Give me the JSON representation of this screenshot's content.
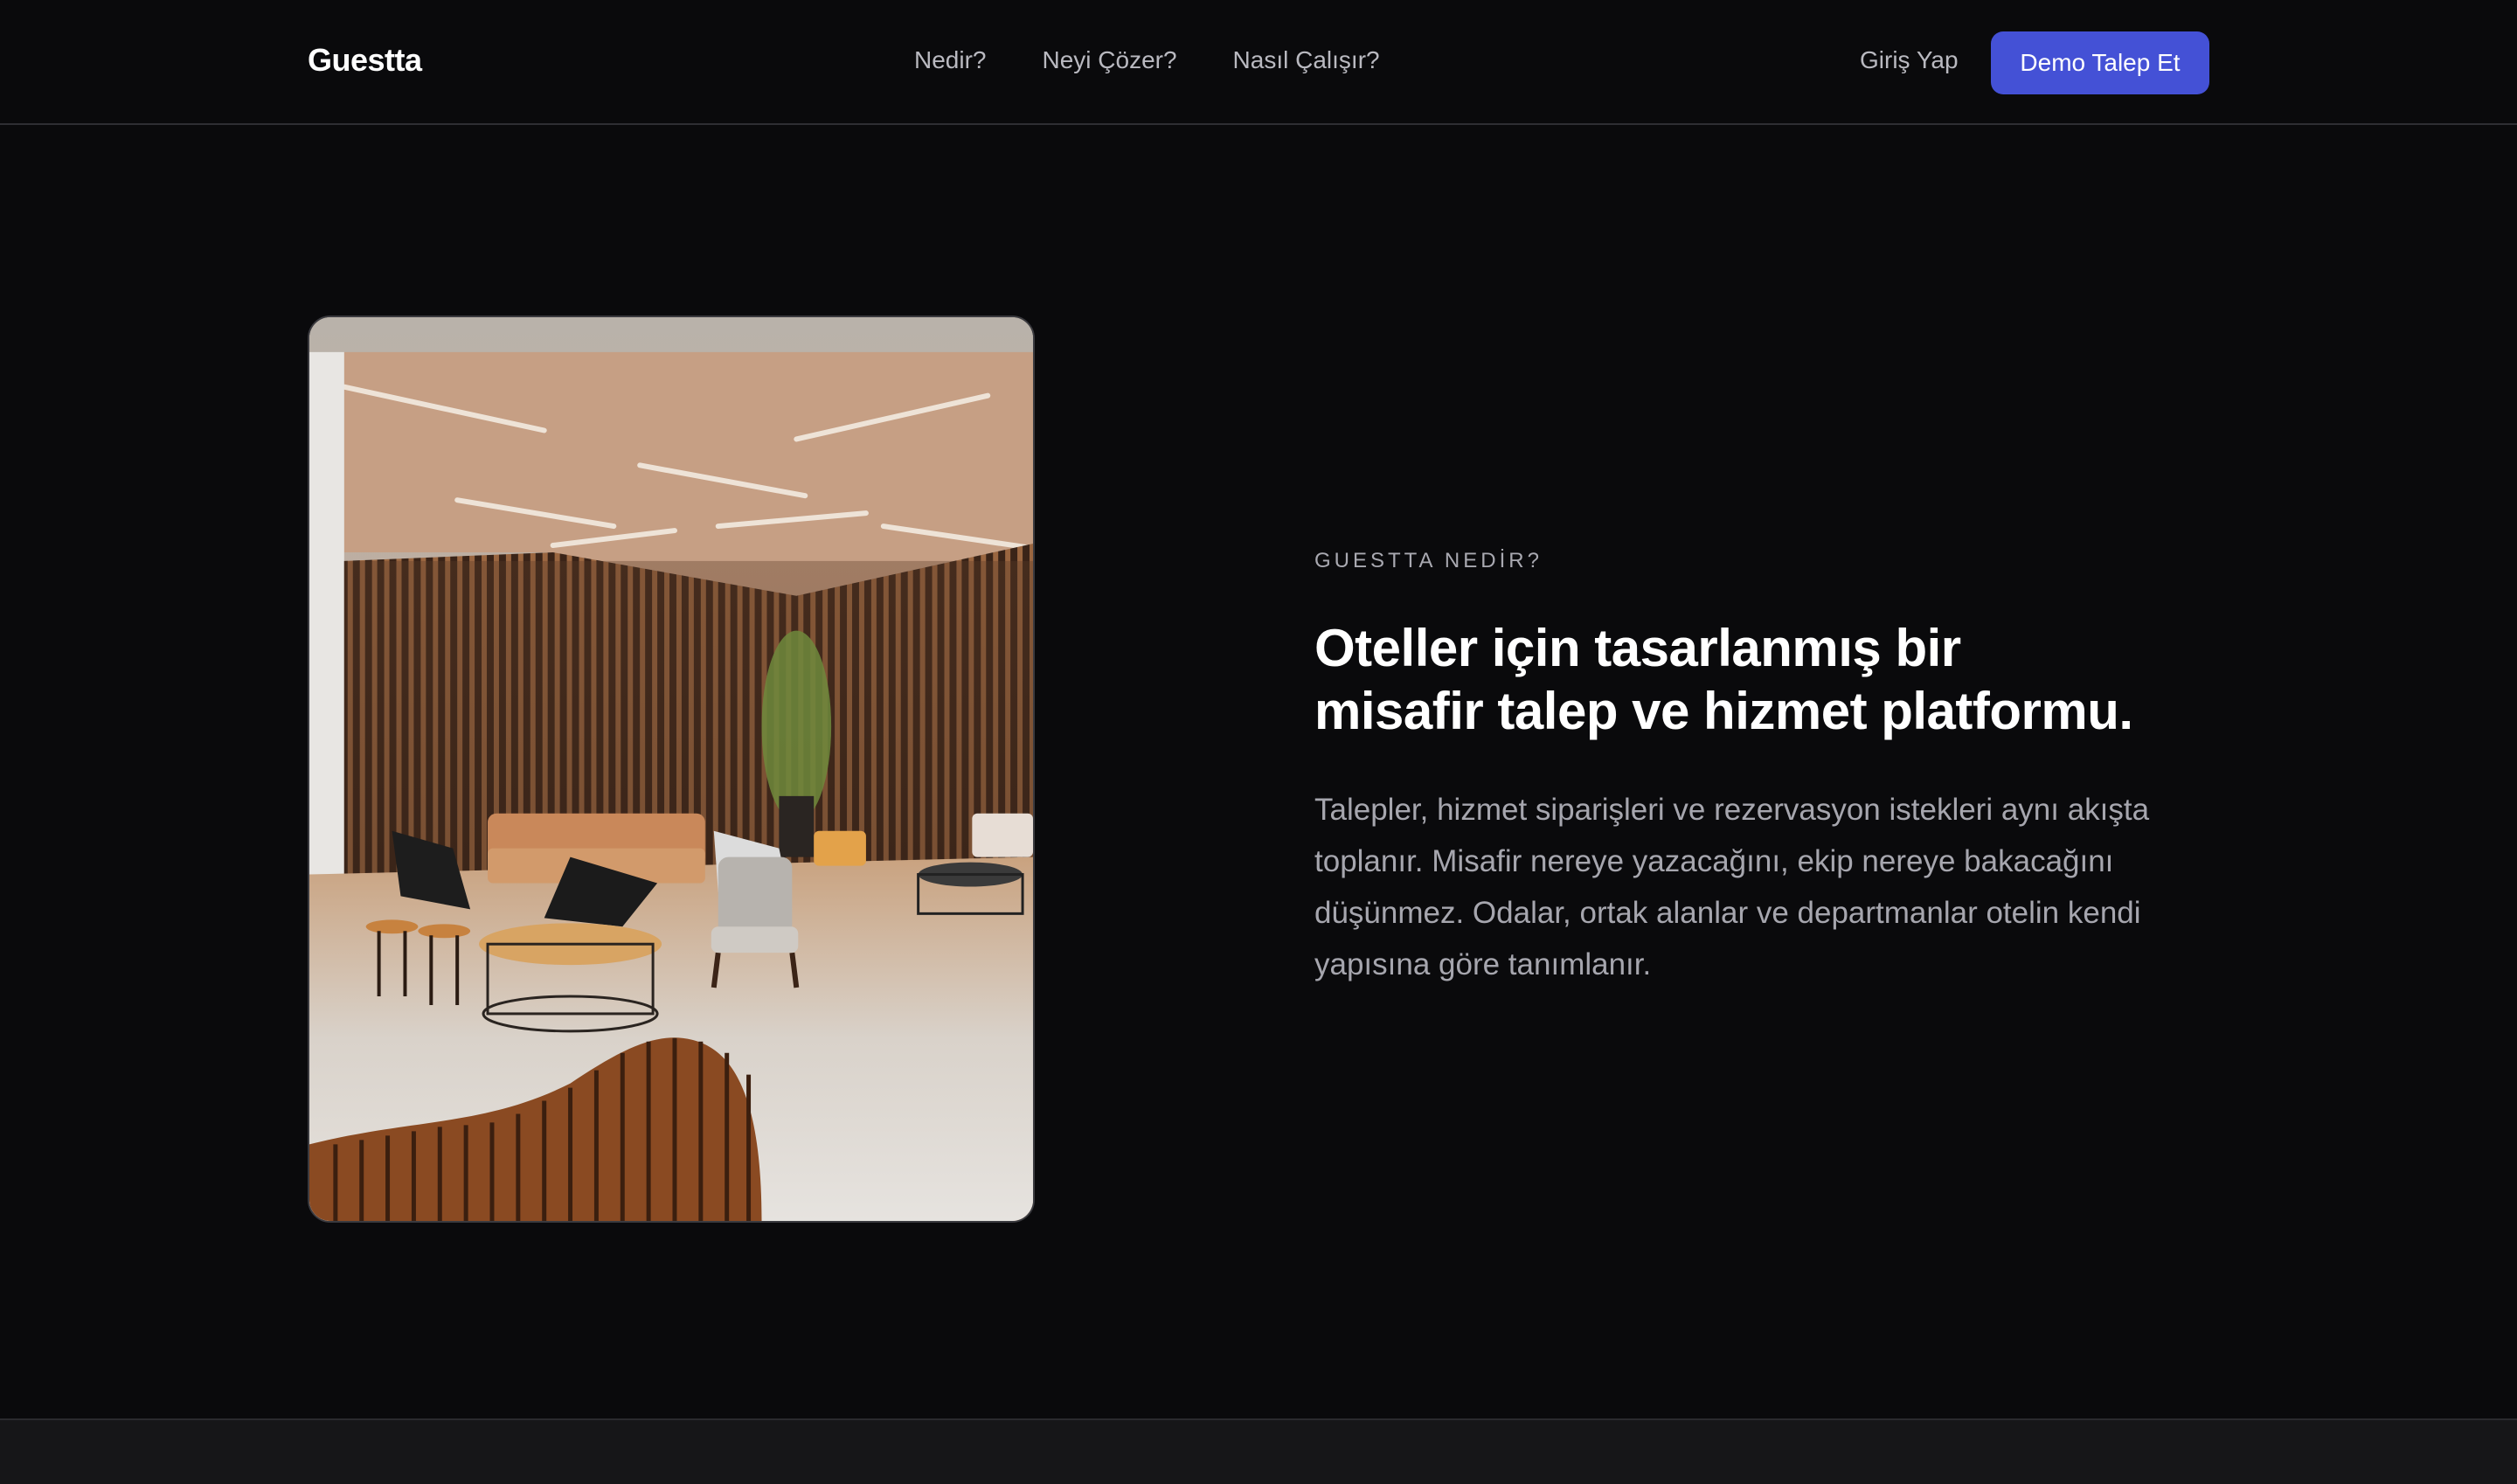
{
  "header": {
    "logo": "Guestta",
    "nav": {
      "nedir": "Nedir?",
      "neyi_cozer": "Neyi Çözer?",
      "nasil_calisir": "Nasıl Çalışır?"
    },
    "login_label": "Giriş Yap",
    "demo_label": "Demo Talep Et"
  },
  "hero": {
    "eyebrow": "GUESTTA NEDİR?",
    "headline_line1": "Oteller için tasarlanmış bir",
    "headline_line2": "misafir talep ve hizmet platformu.",
    "description": "Talepler, hizmet siparişleri ve rezervasyon istekleri aynı akışta toplanır. Misafir nereye yazacağını, ekip nereye bakacağını düşünmez. Odalar, ortak alanlar ve departmanlar otelin kendi yapısına göre tanımlanır."
  },
  "colors": {
    "background": "#0a0a0c",
    "accent": "#4451d6",
    "muted_text": "#a6a6ae",
    "footer_band": "#161618"
  },
  "icons": {
    "hero_image": "hotel-lobby-photo"
  }
}
